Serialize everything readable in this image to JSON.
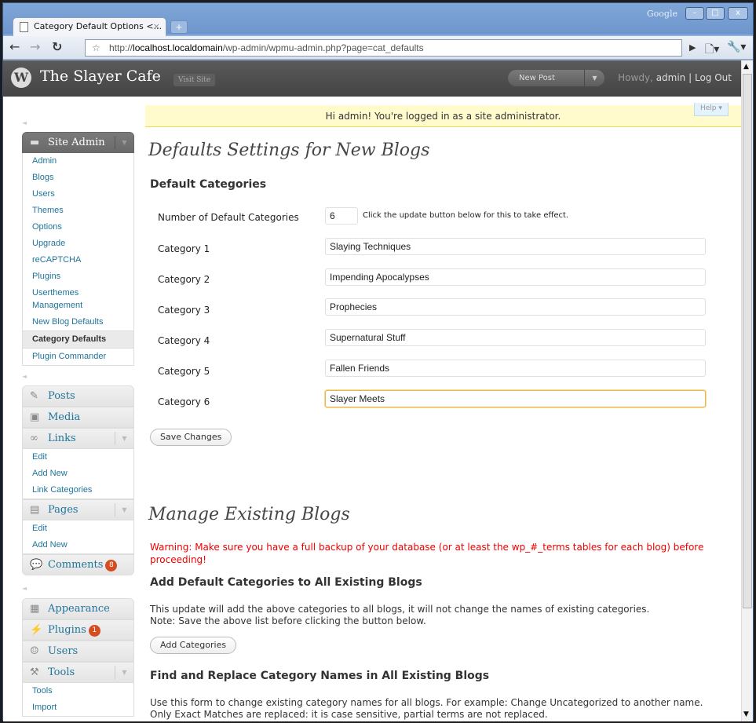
{
  "browser": {
    "tab_title": "Category Default Options <...",
    "google_label": "Google",
    "url_host": "localhost.localdomain",
    "url_path": "/wp-admin/wpmu-admin.php?page=cat_defaults",
    "url_scheme": "http://"
  },
  "header": {
    "site_name": "The Slayer Cafe",
    "visit_site": "Visit Site",
    "new_post": "New Post",
    "howdy": "Howdy,",
    "user": "admin",
    "logout": "Log Out"
  },
  "notice": "Hi admin! You're logged in as a site administrator.",
  "help": "Help",
  "sidebar": {
    "site_admin": {
      "label": "Site Admin",
      "items": [
        "Admin",
        "Blogs",
        "Users",
        "Themes",
        "Options",
        "Upgrade",
        "reCAPTCHA",
        "Plugins",
        "Userthemes Management",
        "New Blog Defaults",
        "Category Defaults",
        "Plugin Commander"
      ]
    },
    "posts": "Posts",
    "media": "Media",
    "links": {
      "label": "Links",
      "items": [
        "Edit",
        "Add New",
        "Link Categories"
      ]
    },
    "pages": {
      "label": "Pages",
      "items": [
        "Edit",
        "Add New"
      ]
    },
    "comments": {
      "label": "Comments",
      "count": "8"
    },
    "appearance": "Appearance",
    "plugins": {
      "label": "Plugins",
      "count": "1"
    },
    "users": "Users",
    "tools": {
      "label": "Tools",
      "items": [
        "Tools",
        "Import"
      ]
    }
  },
  "main": {
    "title": "Defaults Settings for New Blogs",
    "section1": "Default Categories",
    "num_label": "Number of Default Categories",
    "num_value": "6",
    "num_hint": "Click the update button below for this to take effect.",
    "categories": [
      {
        "label": "Category 1",
        "value": "Slaying Techniques"
      },
      {
        "label": "Category 2",
        "value": "Impending Apocalypses"
      },
      {
        "label": "Category 3",
        "value": "Prophecies"
      },
      {
        "label": "Category 4",
        "value": "Supernatural Stuff"
      },
      {
        "label": "Category 5",
        "value": "Fallen Friends"
      },
      {
        "label": "Category 6",
        "value": "Slayer Meets"
      }
    ],
    "save": "Save Changes",
    "title2": "Manage Existing Blogs",
    "warning": "Warning: Make sure you have a full backup of your database (or at least the wp_#_terms tables for each blog) before proceeding!",
    "add_title": "Add Default Categories to All Existing Blogs",
    "add_desc1": "This update will add the above categories to all blogs, it will not change the names of existing categories.",
    "add_desc2": "Note: Save the above list before clicking the button below.",
    "add_btn": "Add Categories",
    "replace_title": "Find and Replace Category Names in All Existing Blogs",
    "replace_desc1": "Use this form to change existing category names for all blogs. For example: Change Uncategorized to another name.",
    "replace_desc2": "Only Exact Matches are replaced: it is case sensitive, partial terms are not replaced."
  }
}
